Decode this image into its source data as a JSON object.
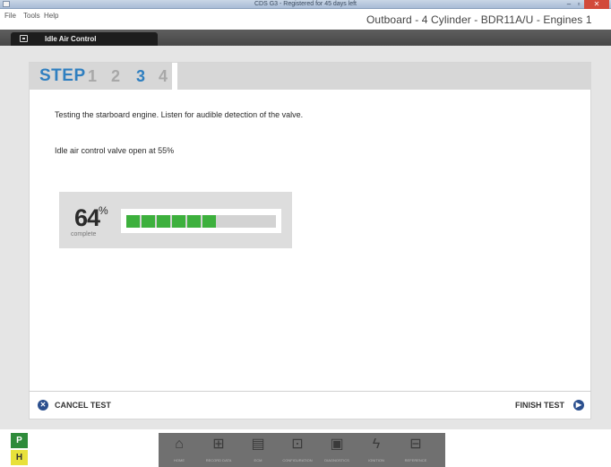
{
  "window": {
    "title": "CDS G3 - Registered for 45 days left",
    "min_glyph": "–",
    "max_glyph": "▫",
    "close_glyph": "✕"
  },
  "menubar": {
    "items": [
      "File",
      "Tools",
      "Help"
    ],
    "engine_title": "Outboard - 4 Cylinder - BDR11A/U - Engines 1"
  },
  "app_tab": {
    "label": "Idle Air Control",
    "icon": "monitor-icon"
  },
  "steps": {
    "label": "STEP",
    "numbers": [
      "1",
      "2",
      "3",
      "4"
    ],
    "current": 3
  },
  "content": {
    "instruction": "Testing the starboard engine. Listen for audible detection of the valve.",
    "valve_status": "Idle air control valve open at 55%"
  },
  "progress": {
    "value": "64",
    "unit": "%",
    "label": "complete",
    "filled_segments": 6,
    "total_segments": 10,
    "bar_color": "#3db03d"
  },
  "actions": {
    "cancel": "CANCEL TEST",
    "finish": "FINISH TEST",
    "cancel_icon": "close-circle-icon",
    "finish_icon": "arrow-right-circle-icon"
  },
  "status_badges": {
    "p": "P",
    "h": "H"
  },
  "dock": {
    "items": [
      {
        "name": "home",
        "icon": "home-icon",
        "glyph": "⌂",
        "label": "HOME"
      },
      {
        "name": "recorded-data",
        "icon": "tree-icon",
        "glyph": "⊞",
        "label": "RECORD DATA"
      },
      {
        "name": "ecm",
        "icon": "document-icon",
        "glyph": "▤",
        "label": "ECM"
      },
      {
        "name": "configuration",
        "icon": "engine-icon",
        "glyph": "⊡",
        "label": "CONFIGURATION"
      },
      {
        "name": "diagnostics",
        "icon": "monitor-icon",
        "glyph": "▣",
        "label": "DIAGNOSTICS"
      },
      {
        "name": "ignition",
        "icon": "lightning-icon",
        "glyph": "ϟ",
        "label": "IGNITION"
      },
      {
        "name": "reference",
        "icon": "book-icon",
        "glyph": "⊟",
        "label": "REFERENCE"
      }
    ]
  },
  "colors": {
    "accent_blue": "#2f7fc0",
    "header_dark": "#1d1d1d",
    "badge_green": "#2e8b3a",
    "badge_yellow": "#e8e13a"
  }
}
